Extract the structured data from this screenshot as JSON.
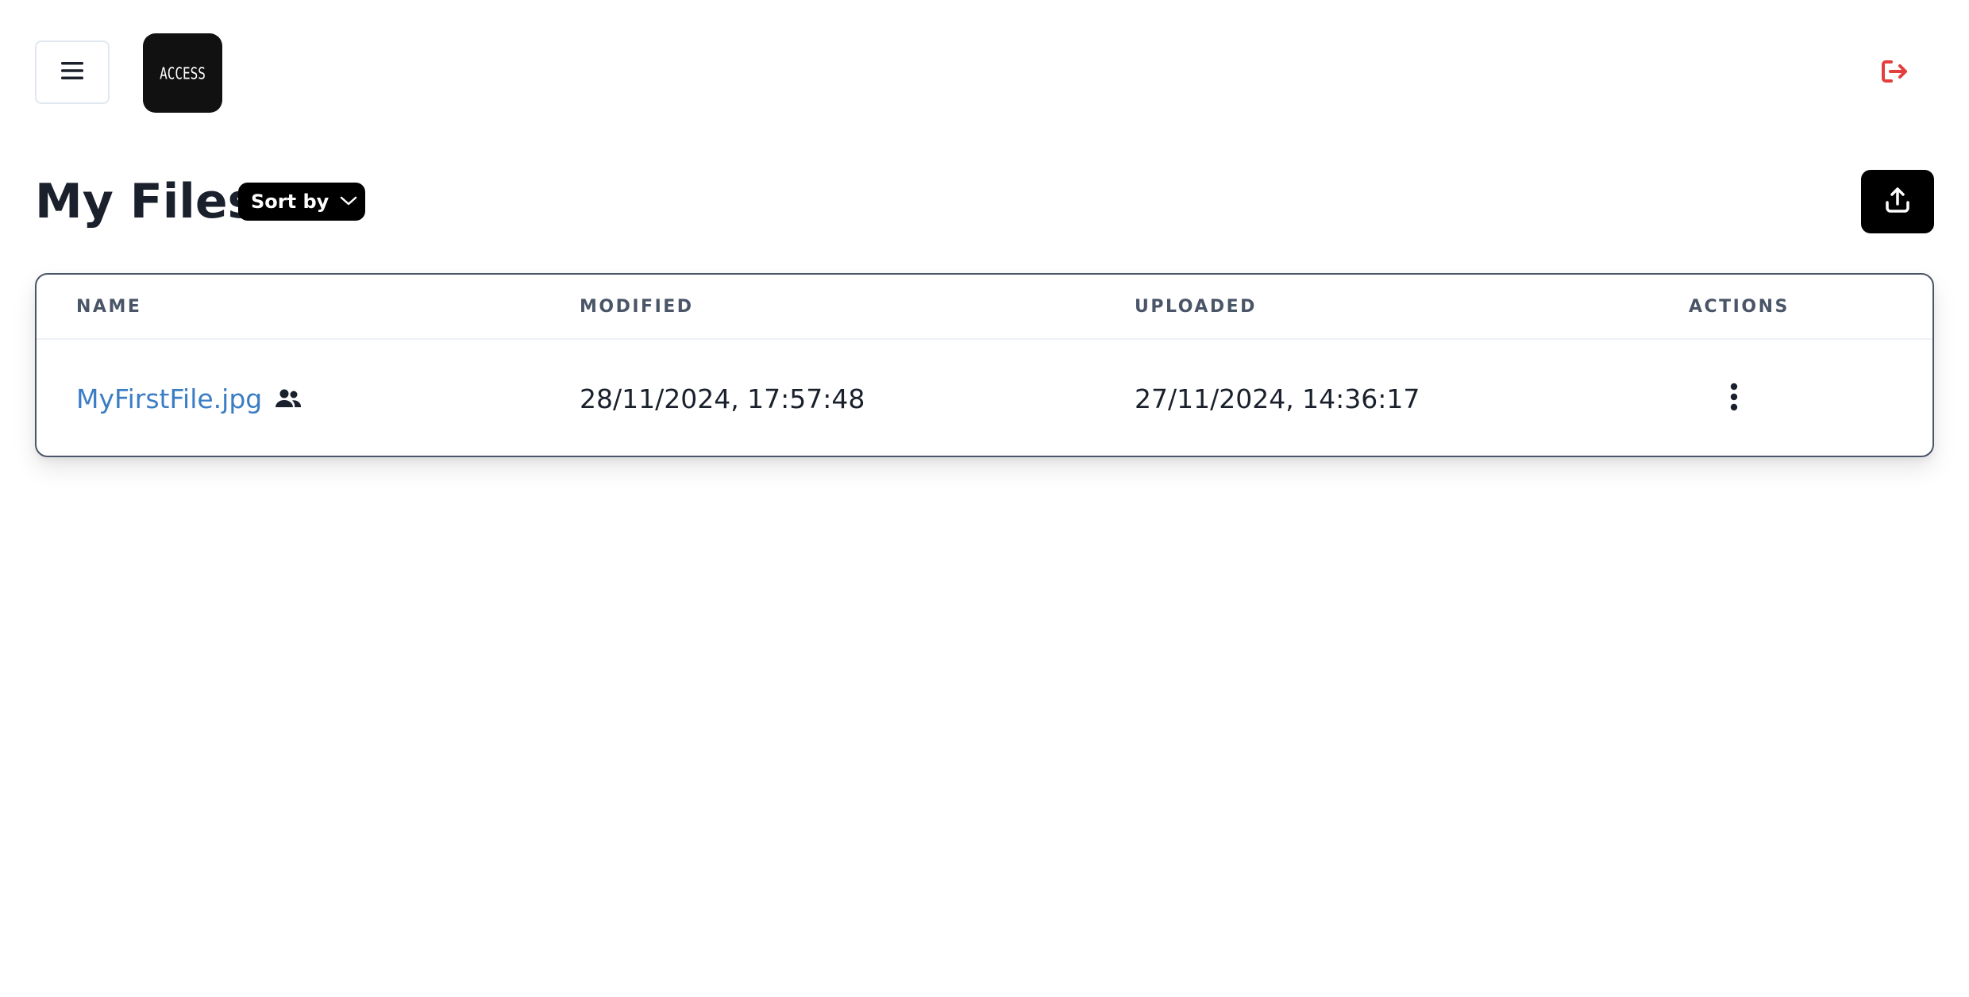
{
  "header": {
    "menu_icon": "hamburger-menu-icon",
    "logo_text": "ACCESS",
    "logout_icon": "logout-icon",
    "logout_color": "#e53e3e"
  },
  "page": {
    "title": "My Files",
    "sort_label": "Sort by",
    "sort_icon": "chevron-down-icon",
    "upload_icon": "upload-icon"
  },
  "table": {
    "columns": [
      "NAME",
      "MODIFIED",
      "UPLOADED",
      "ACTIONS"
    ],
    "rows": [
      {
        "name": "MyFirstFile.jpg",
        "shared_icon": "users-icon",
        "modified": "28/11/2024, 17:57:48",
        "uploaded": "27/11/2024, 14:36:17",
        "actions_icon": "more-vertical-icon"
      }
    ]
  },
  "colors": {
    "link": "#3b7dc4",
    "accent": "#000000",
    "header_text": "#4a5568"
  }
}
